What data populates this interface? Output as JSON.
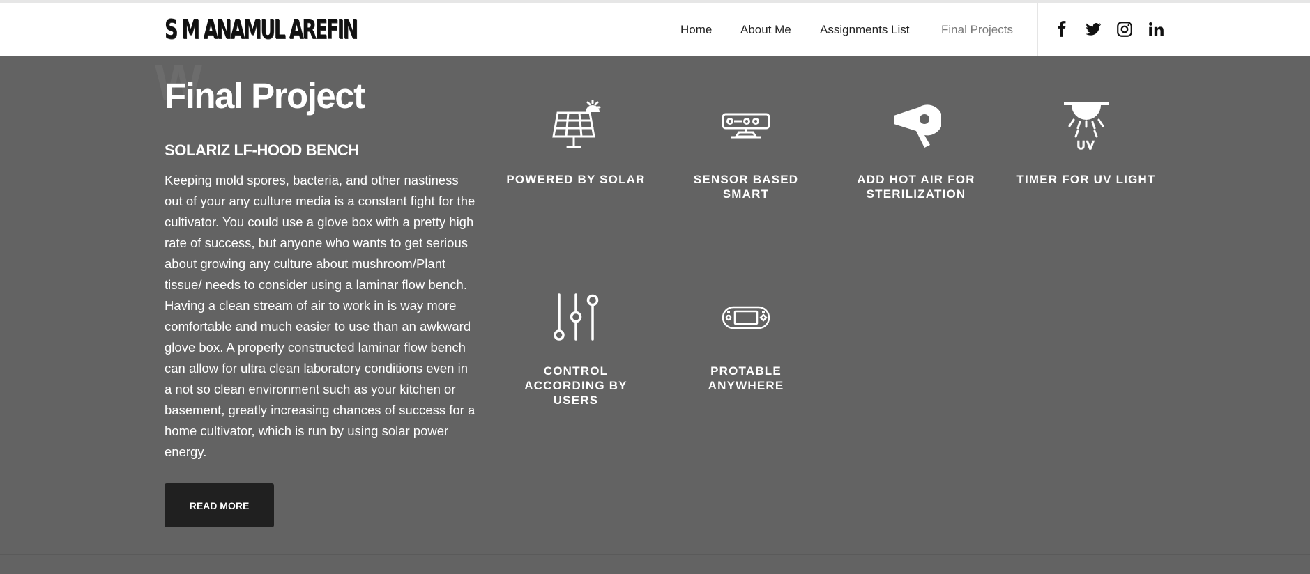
{
  "header": {
    "logo": "S M ANAMUL AREFIN",
    "nav": [
      "Home",
      "About Me",
      "Assignments List",
      "Final Projects"
    ],
    "social": [
      "facebook-icon",
      "twitter-icon",
      "instagram-icon",
      "linkedin-icon"
    ]
  },
  "main": {
    "watermark": "W",
    "title": "Final Project",
    "subtitle": "SOLARIZ LF-HOOD BENCH",
    "description": "Keeping mold spores, bacteria, and other nastiness out of your any culture media is a constant fight for the cultivator. You could use a glove box with a pretty high rate of success, but anyone who wants to get serious about growing any culture about mushroom/Plant tissue/ needs to consider using a laminar flow bench. Having a clean stream of air to work in is way more comfortable and much easier to use than an awkward glove box. A properly constructed laminar flow bench can allow for ultra clean laboratory conditions even in a not so clean environment such as your kitchen or basement, greatly increasing chances of success for a home cultivator, which is run by using solar power energy.",
    "read_more": "READ MORE"
  },
  "features": [
    {
      "label": "POWERED BY SOLAR",
      "icon": "solar-panel-icon"
    },
    {
      "label": "SENSOR BASED SMART",
      "icon": "sensor-icon"
    },
    {
      "label": "ADD HOT AIR FOR STERILIZATION",
      "icon": "hair-dryer-icon"
    },
    {
      "label": "TIMER FOR UV LIGHT",
      "icon": "uv-light-icon"
    },
    {
      "label": "CONTROL ACCORDING BY USERS",
      "icon": "sliders-icon"
    },
    {
      "label": "PROTABLE ANYWHERE",
      "icon": "handheld-device-icon"
    }
  ],
  "colors": {
    "background": "#636363",
    "header": "#ffffff",
    "button": "#202020",
    "active_nav": "#7a7a7a"
  }
}
